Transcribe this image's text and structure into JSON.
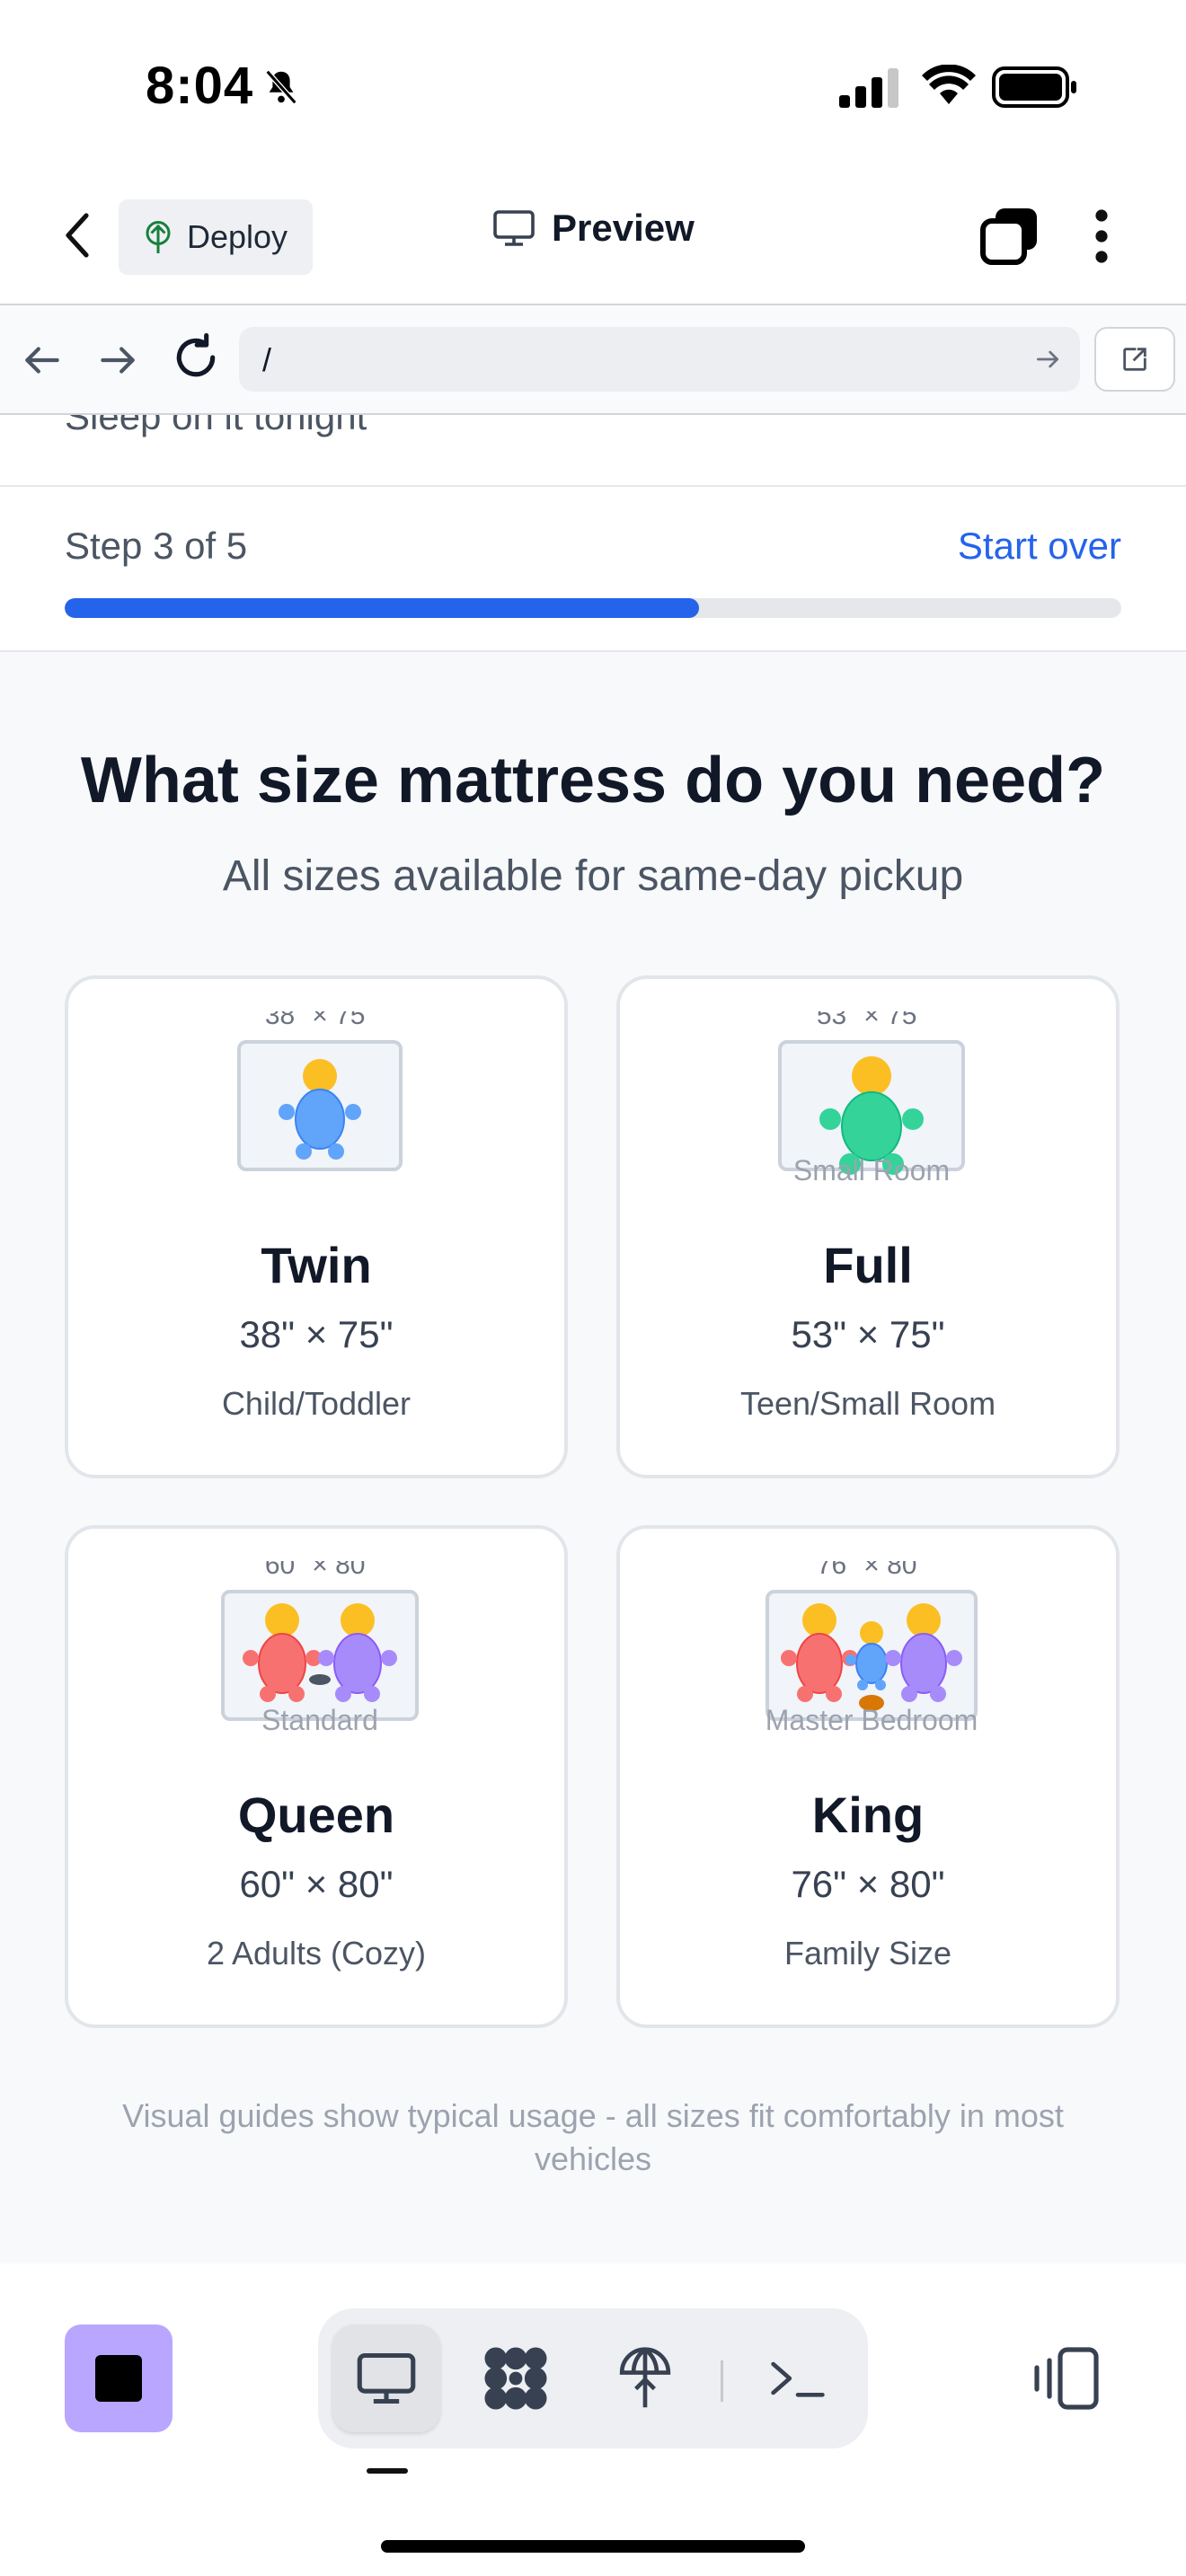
{
  "status_bar": {
    "time": "8:04"
  },
  "header": {
    "deploy_label": "Deploy",
    "title": "Preview"
  },
  "browser": {
    "url": "/"
  },
  "page": {
    "top_partial_text": "Sleep on it tonight",
    "step_label": "Step 3 of 5",
    "start_over": "Start over",
    "progress_fraction": 0.6,
    "headline": "What size mattress do you need?",
    "subheadline": "All sizes available for same-day pickup",
    "cards": [
      {
        "name": "Twin",
        "dims": "38\" × 75\"",
        "use": "Child/Toddler",
        "illus_dims": "38\" × 75\"",
        "illus_caption": ""
      },
      {
        "name": "Full",
        "dims": "53\" × 75\"",
        "use": "Teen/Small Room",
        "illus_dims": "53\" × 75\"",
        "illus_caption": "Small Room"
      },
      {
        "name": "Queen",
        "dims": "60\" × 80\"",
        "use": "2 Adults (Cozy)",
        "illus_dims": "60\" × 80\"",
        "illus_caption": "Standard"
      },
      {
        "name": "King",
        "dims": "76\" × 80\"",
        "use": "Family Size",
        "illus_dims": "76\" × 80\"",
        "illus_caption": "Master Bedroom"
      }
    ],
    "footer_note": "Visual guides show typical usage - all sizes fit comfortably in most vehicles"
  },
  "colors": {
    "accent": "#2563eb",
    "stop_button": "#b9a6ff",
    "person_blue": "#60a5fa",
    "person_green": "#34d399",
    "person_red": "#f87171",
    "person_purple": "#a78bfa",
    "person_head": "#fbbf24"
  },
  "bottom_bar": {
    "icons": [
      "desktop-icon",
      "dots-grid-icon",
      "deploy-icon",
      "terminal-icon"
    ],
    "right_icon": "devices-icon"
  }
}
